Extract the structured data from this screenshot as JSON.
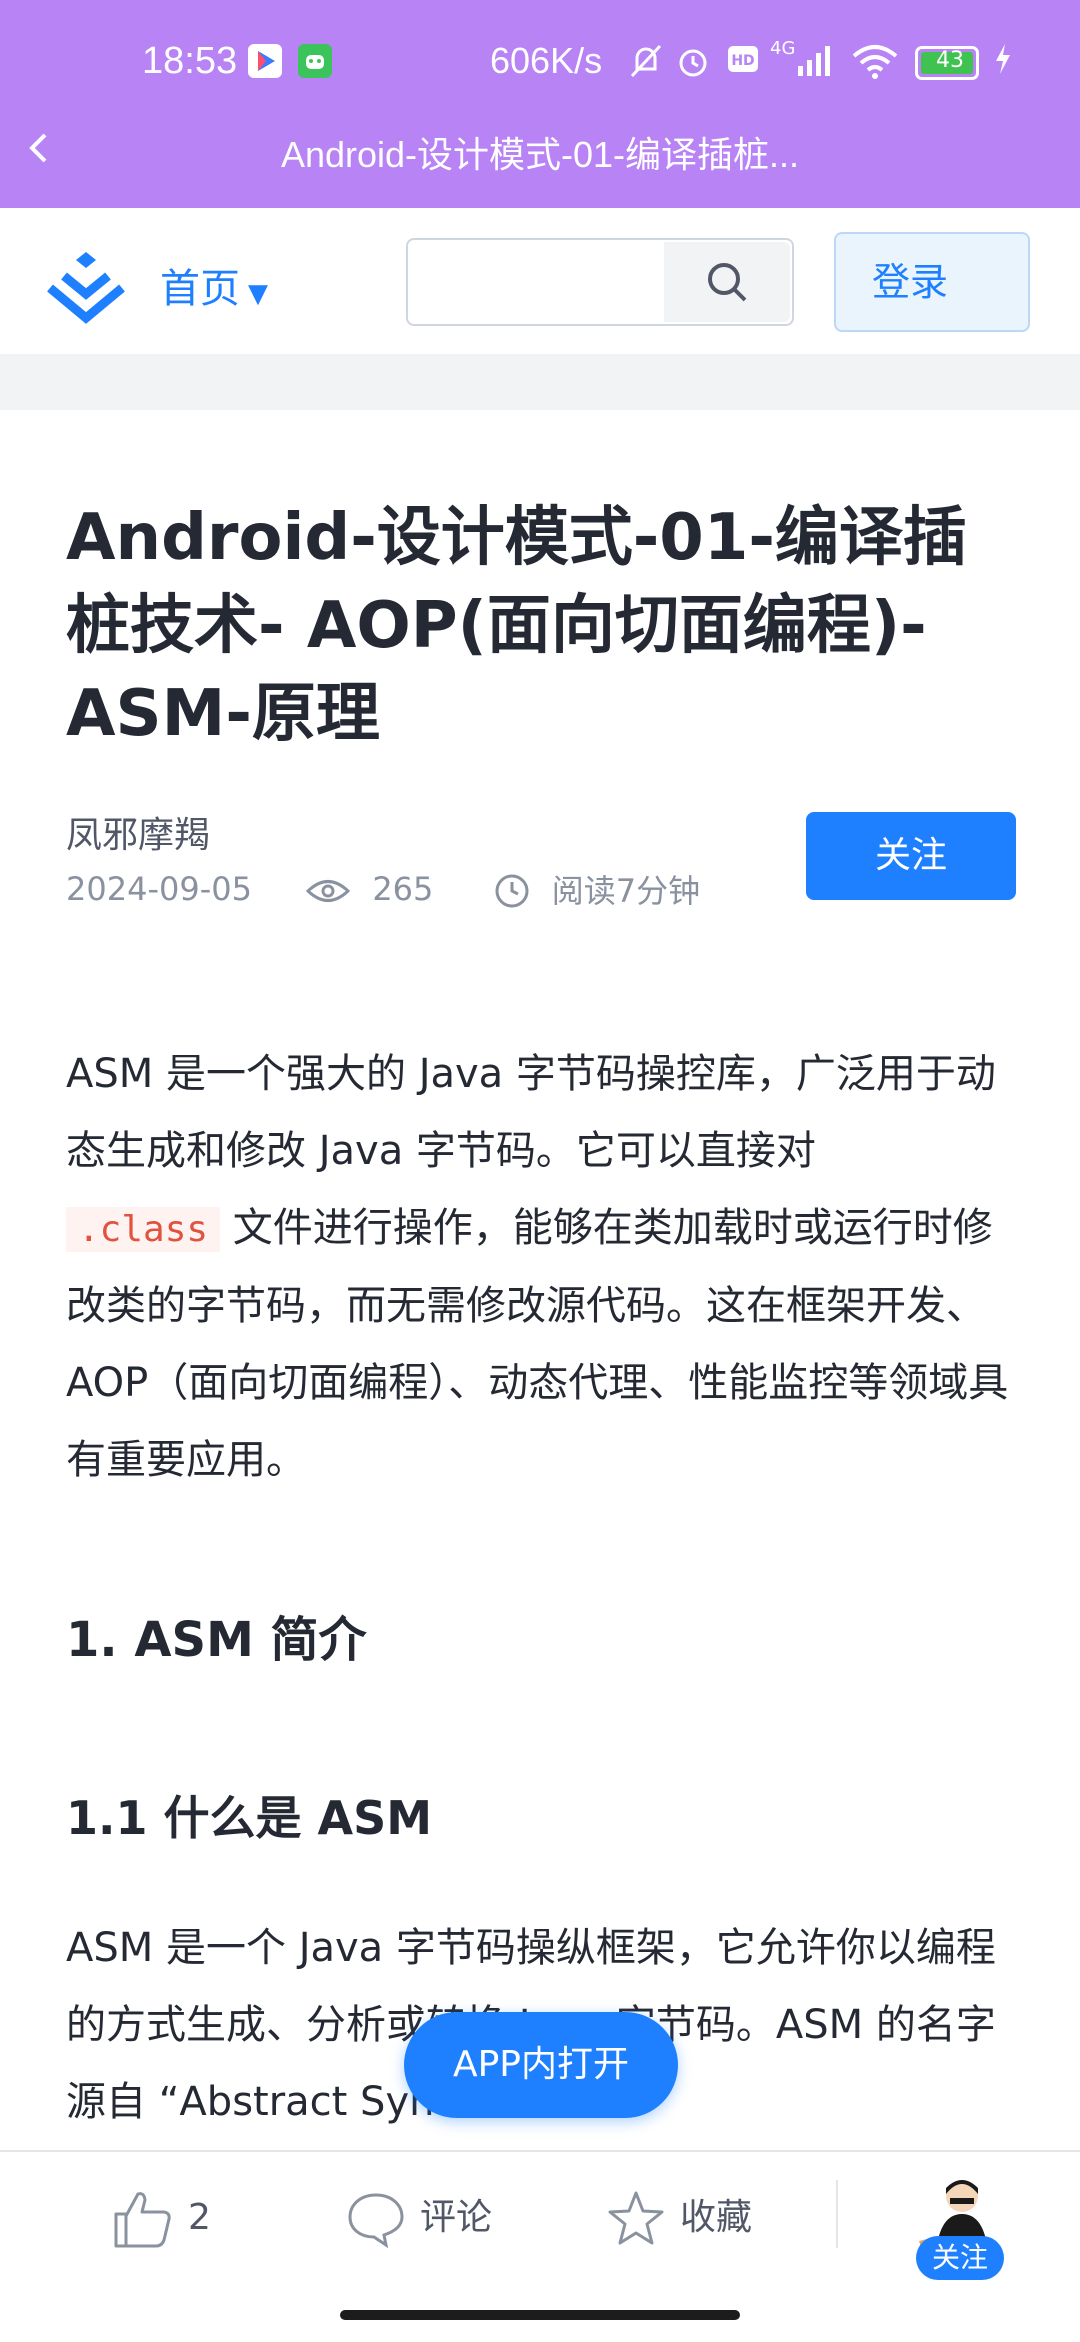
{
  "status_bar": {
    "time": "18:53",
    "net_speed": "606K/s",
    "signal": "4G",
    "battery": "43"
  },
  "app_bar": {
    "title": "Android-设计模式-01-编译插桩..."
  },
  "site_header": {
    "home_label": "首页",
    "login_label": "登录",
    "search_placeholder": ""
  },
  "article": {
    "title": "Android-设计模式-01-编译插桩技术- AOP(面向切面编程)-ASM-原理",
    "author": "凤邪摩羯",
    "date": "2024-09-05",
    "views": "265",
    "read_time": "阅读7分钟",
    "follow_label": "关注",
    "para1_a": "ASM 是一个强大的 Java 字节码操控库，广泛用于动态生成和修改 Java 字节码。它可以直接对",
    "para1_code": ".class",
    "para1_b": "文件进行操作，能够在类加载时或运行时修改类的字节码，而无需修改源代码。这在框架开发、AOP（面向切面编程）、动态代理、性能监控等领域具有重要应用。",
    "h2": "1. ASM 简介",
    "h3": "1.1 什么是 ASM",
    "para2": "ASM 是一个 Java 字节码操纵框架，它允许你以编程的方式生成、分析或转换 Java 字节码。ASM 的名字源自 “Abstract Syntax Tree”"
  },
  "open_app_label": "APP内打开",
  "bottom_bar": {
    "like_count": "2",
    "comment_label": "评论",
    "collect_label": "收藏",
    "follow_badge": "关注"
  },
  "colors": {
    "accent": "#1e80ff",
    "app_bar": "#b883f5"
  }
}
